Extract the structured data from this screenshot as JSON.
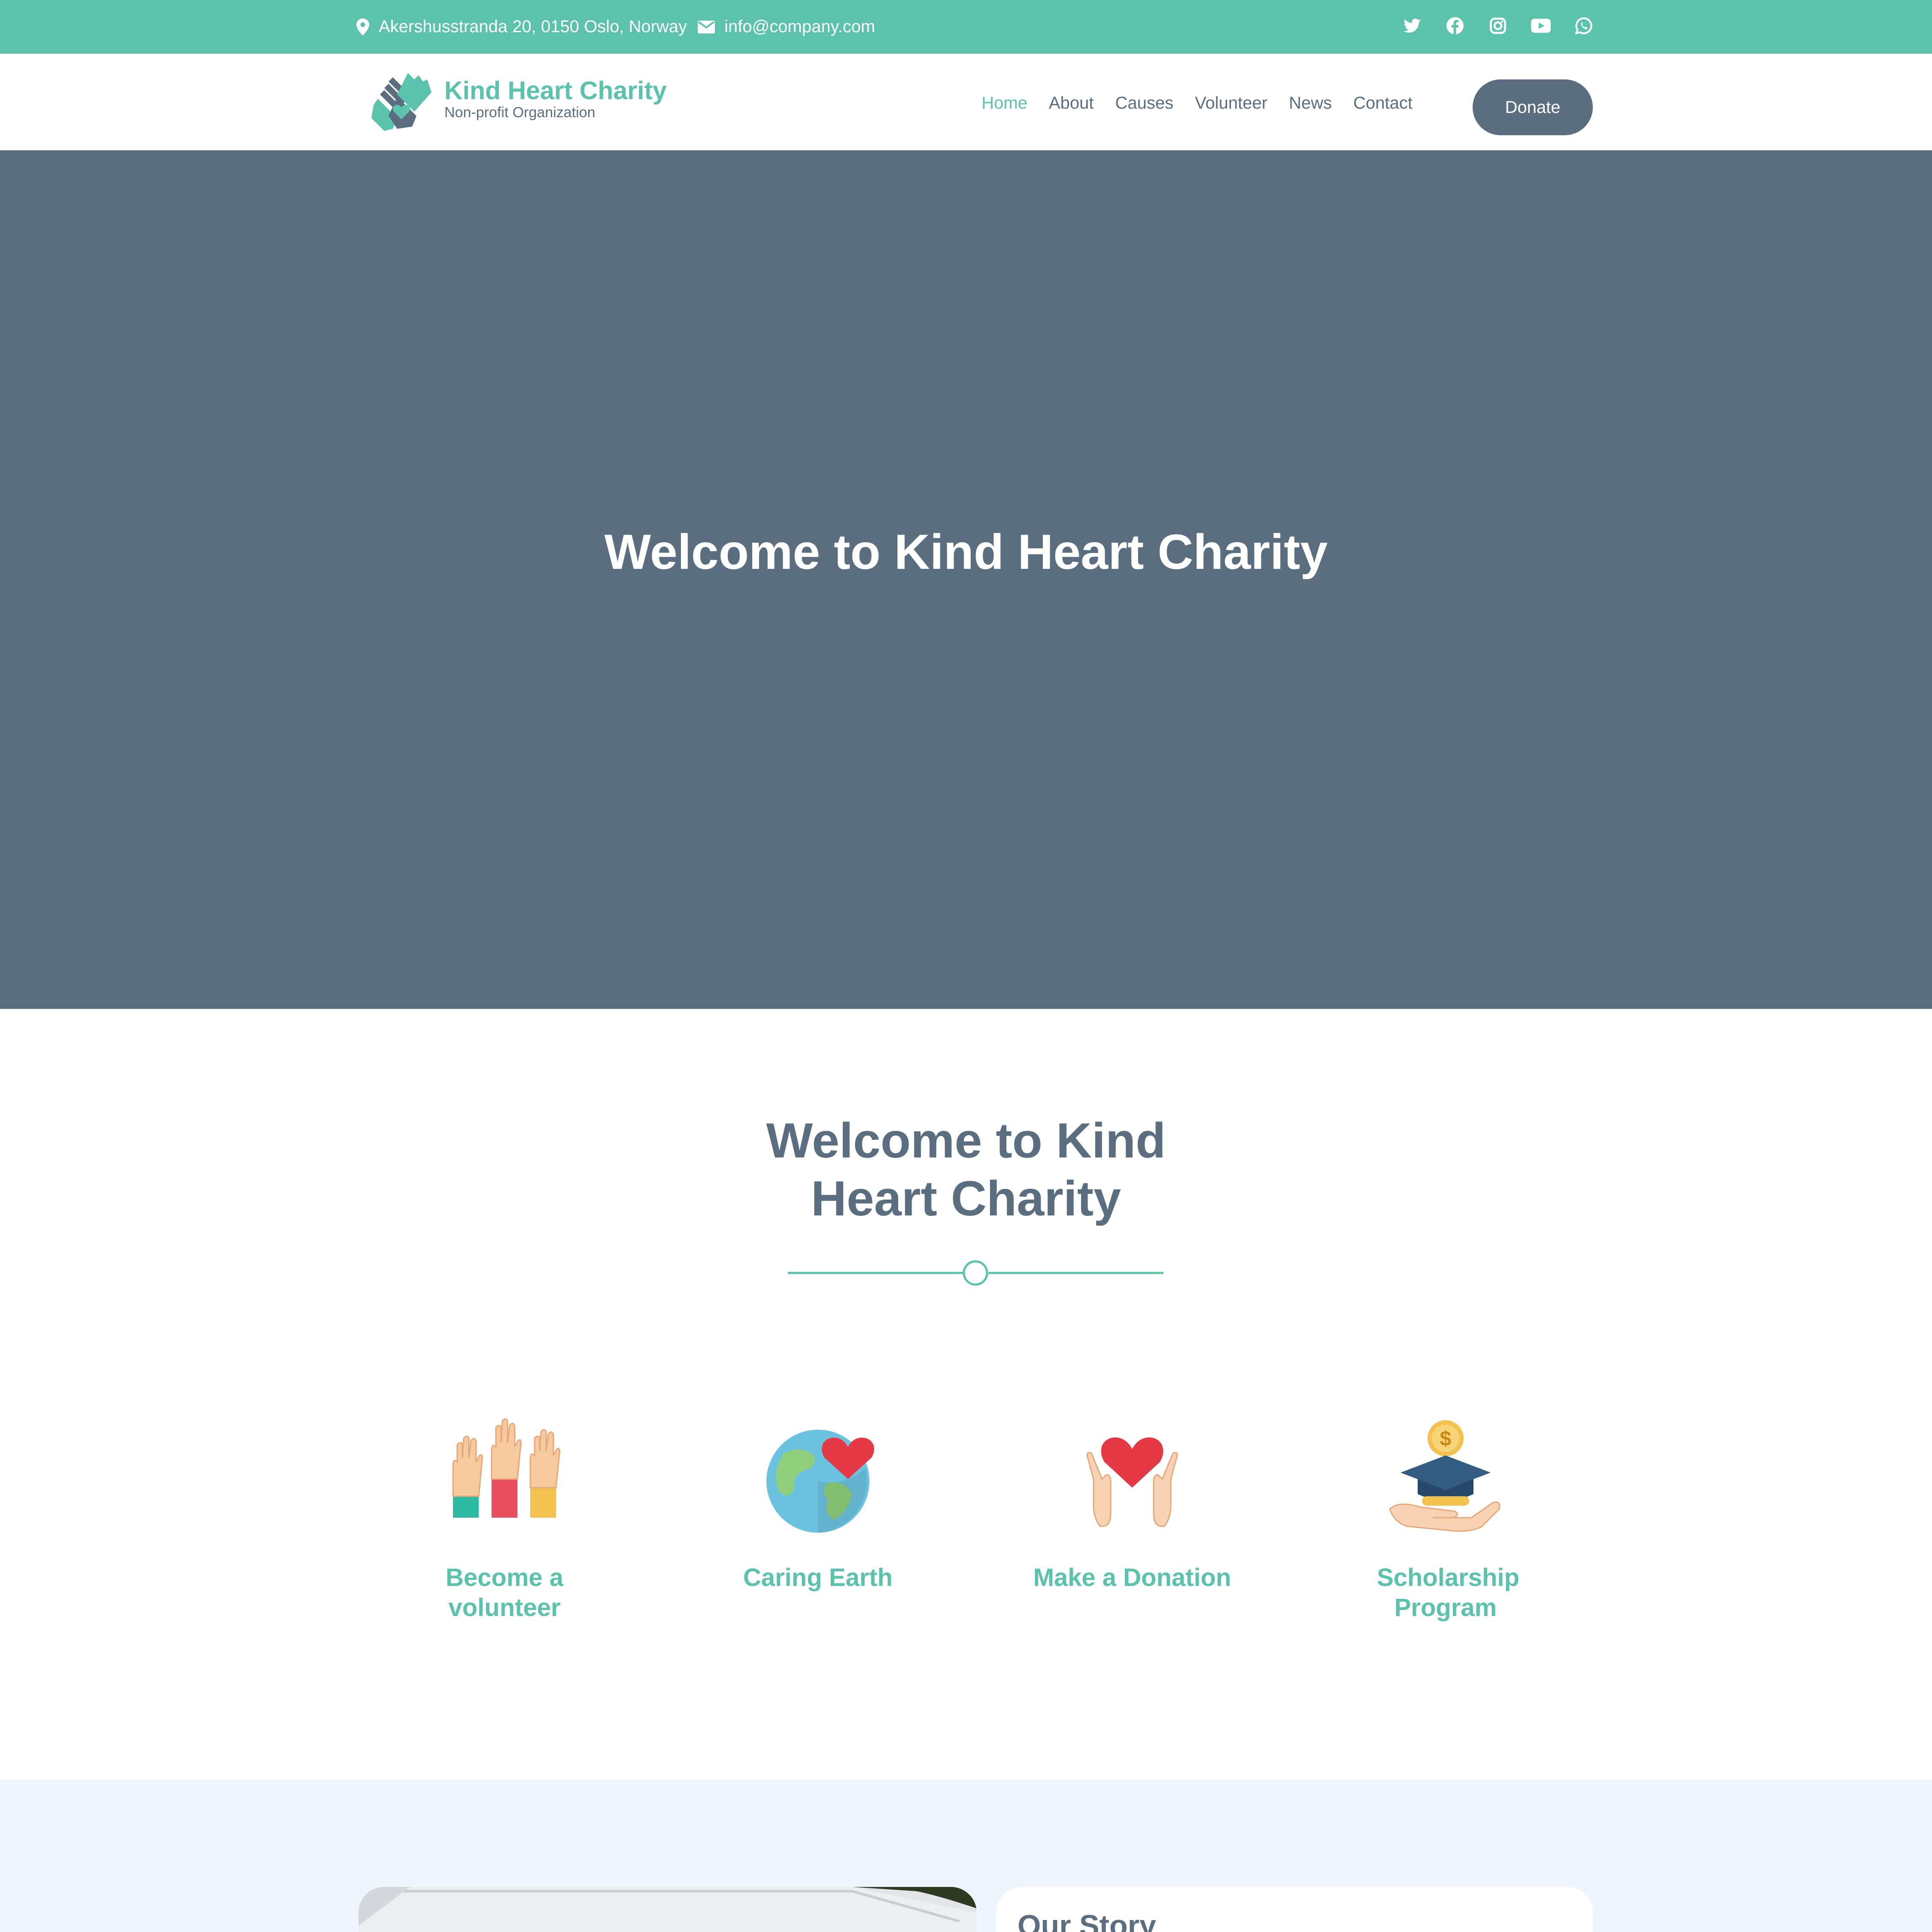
{
  "topbar": {
    "address": "Akershusstranda 20, 0150 Oslo, Norway",
    "email": "info@company.com",
    "social": [
      "twitter-icon",
      "facebook-icon",
      "instagram-icon",
      "youtube-icon",
      "whatsapp-icon"
    ]
  },
  "header": {
    "brand_name": "Kind Heart Charity",
    "brand_tagline": "Non-profit Organization",
    "nav": [
      {
        "label": "Home",
        "active": true
      },
      {
        "label": "About"
      },
      {
        "label": "Causes"
      },
      {
        "label": "Volunteer"
      },
      {
        "label": "News"
      },
      {
        "label": "Contact"
      }
    ],
    "donate_label": "Donate"
  },
  "hero": {
    "title": "Welcome to Kind Heart Charity"
  },
  "welcome": {
    "title": "Welcome to Kind Heart Charity",
    "features": [
      {
        "label": "Become a volunteer",
        "icon": "raised-hands-icon"
      },
      {
        "label": "Caring Earth",
        "icon": "earth-heart-icon"
      },
      {
        "label": "Make a Donation",
        "icon": "hands-heart-icon"
      },
      {
        "label": "Scholarship Program",
        "icon": "graduation-cap-coin-icon"
      }
    ]
  },
  "story": {
    "title": "Our Story"
  },
  "colors": {
    "accent": "#5bc2ac",
    "primary": "#5b6e80",
    "story_bg": "#eef5fc"
  }
}
